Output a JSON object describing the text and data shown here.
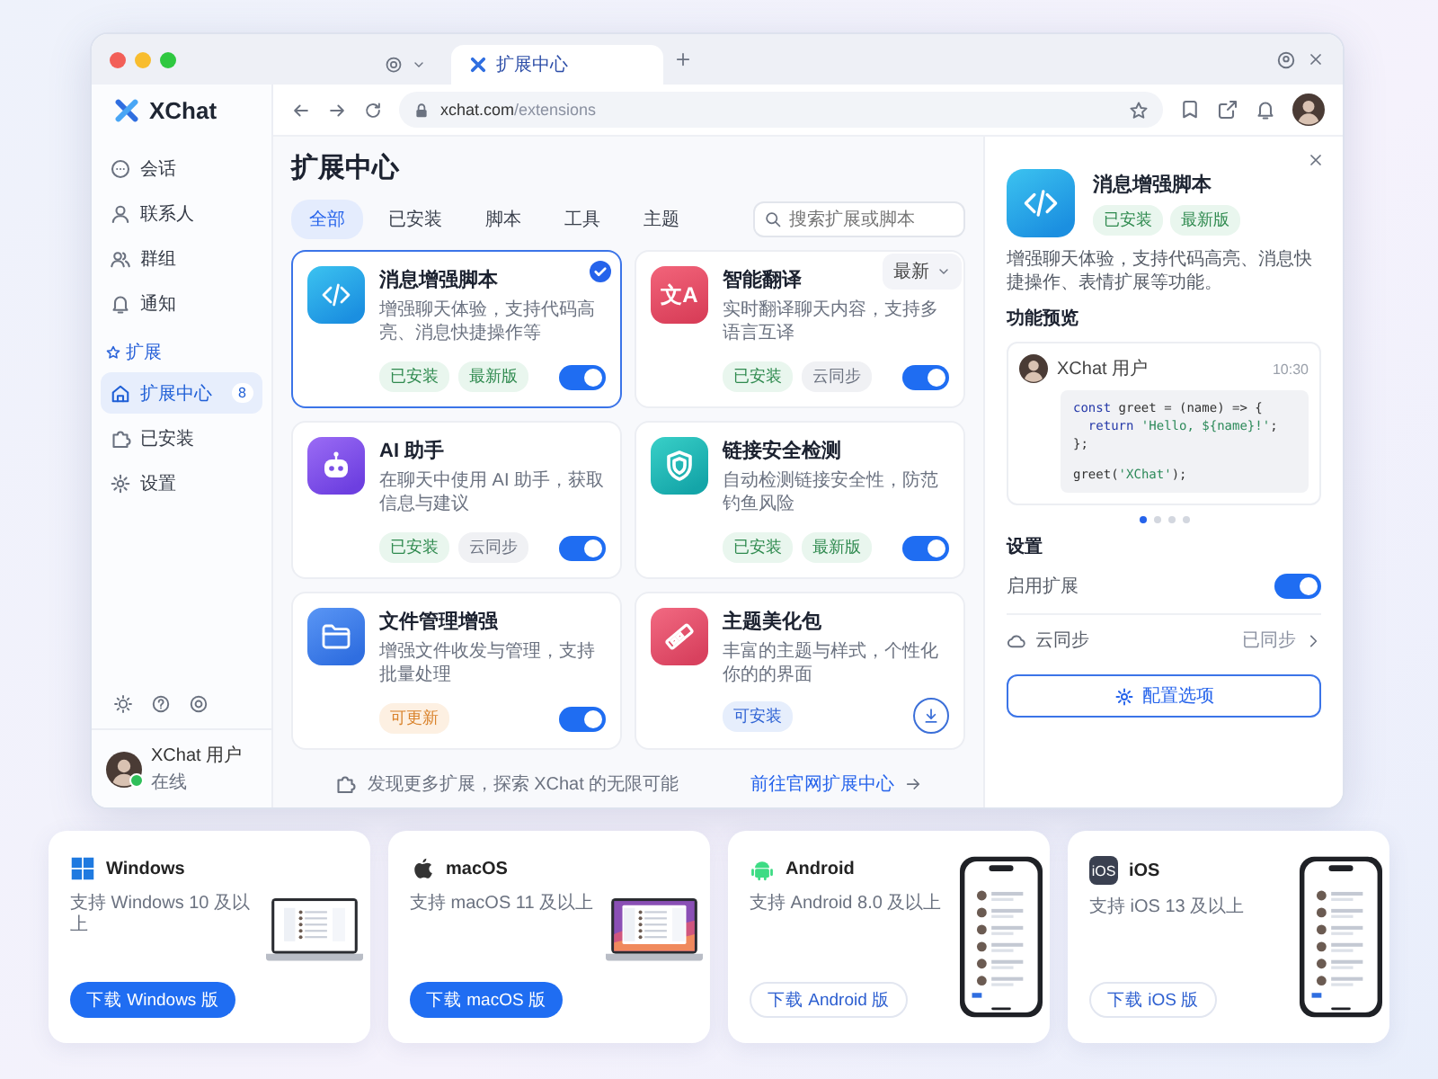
{
  "browser": {
    "tabs": [
      {
        "kind": "menu",
        "selected": false
      },
      {
        "kind": "page",
        "label": "扩展中心",
        "selected": true
      }
    ],
    "url_host": "xchat.com",
    "url_path": "/extensions"
  },
  "sidebar": {
    "app_name": "XChat",
    "groups": [
      {
        "items": [
          {
            "label": "会话",
            "kind": "chat",
            "selected": false
          },
          {
            "label": "联系人",
            "kind": "contact",
            "selected": false
          },
          {
            "label": "群组",
            "kind": "group",
            "selected": false
          },
          {
            "label": "通知",
            "kind": "bell",
            "selected": false
          }
        ]
      },
      {
        "title": "扩展",
        "items": [
          {
            "label": "扩展中心",
            "kind": "store",
            "selected": true,
            "badge": "8"
          },
          {
            "label": "已安装",
            "kind": "puzzle",
            "selected": false
          },
          {
            "label": "设置",
            "kind": "gear",
            "selected": false
          }
        ]
      }
    ],
    "user": {
      "name": "XChat 用户",
      "status": "在线",
      "online": true
    }
  },
  "main": {
    "title": "扩展中心",
    "filters": [
      {
        "label": "全部",
        "selected": true
      },
      {
        "label": "已安装",
        "selected": false
      },
      {
        "label": "脚本",
        "selected": false
      },
      {
        "label": "工具",
        "selected": false
      },
      {
        "label": "主题",
        "selected": false
      }
    ],
    "search": {
      "placeholder": "搜索扩展或脚本"
    },
    "sort": {
      "label": "最新"
    },
    "extensions": [
      {
        "name": "消息增强脚本",
        "description": "增强聊天体验，支持代码高亮、消息快捷操作等",
        "kind": "code",
        "selected": true,
        "tags": [
          {
            "label": "已安装",
            "kind": "success"
          },
          {
            "label": "最新版",
            "kind": "success"
          }
        ],
        "on": true
      },
      {
        "name": "智能翻译",
        "description": "实时翻译聊天内容，支持多语言互译",
        "kind": "translate",
        "icon_text": "文A",
        "selected": false,
        "tags": [
          {
            "label": "已安装",
            "kind": "success"
          },
          {
            "label": "云同步",
            "kind": "neutral"
          }
        ],
        "on": true
      },
      {
        "name": "AI 助手",
        "description": "在聊天中使用 AI 助手，获取信息与建议",
        "kind": "robot",
        "selected": false,
        "tags": [
          {
            "label": "已安装",
            "kind": "success"
          },
          {
            "label": "云同步",
            "kind": "neutral"
          }
        ],
        "on": true
      },
      {
        "name": "链接安全检测",
        "description": "自动检测链接安全性，防范钓鱼风险",
        "kind": "shield",
        "selected": false,
        "tags": [
          {
            "label": "已安装",
            "kind": "success"
          },
          {
            "label": "最新版",
            "kind": "success"
          }
        ],
        "on": true
      },
      {
        "name": "文件管理增强",
        "description": "增强文件收发与管理，支持批量处理",
        "kind": "folder",
        "selected": false,
        "tags": [
          {
            "label": "可更新",
            "kind": "warning"
          }
        ],
        "on": true
      },
      {
        "name": "主题美化包",
        "description": "丰富的主题与样式，个性化你的的界面",
        "kind": "brush",
        "selected": false,
        "tags": [
          {
            "label": "可安装",
            "kind": "info"
          }
        ]
      }
    ],
    "footer": {
      "text": "发现更多扩展，探索 XChat 的无限可能",
      "link": "前往官网扩展中心"
    }
  },
  "detail": {
    "name": "消息增强脚本",
    "kind": "code",
    "tags": [
      {
        "label": "已安装",
        "kind": "success"
      },
      {
        "label": "最新版",
        "kind": "success"
      }
    ],
    "description": "增强聊天体验，支持代码高亮、消息快捷操作、表情扩展等功能。",
    "preview_title": "功能预览",
    "preview": {
      "user": "XChat 用户",
      "time": "10:30",
      "code": [
        [
          [
            {
              "kind": "keyword",
              "t": "const"
            },
            {
              "kind": "plain",
              "t": " greet = (name) => {"
            }
          ],
          [
            {
              "kind": "keyword",
              "t": "  return"
            },
            {
              "kind": "string",
              "t": " 'Hello, ${name}!'"
            },
            {
              "kind": "plain",
              "t": ";"
            }
          ],
          [
            {
              "kind": "plain",
              "t": "};"
            }
          ]
        ],
        [
          [
            {
              "kind": "plain",
              "t": "greet("
            },
            {
              "kind": "string",
              "t": "'XChat'"
            },
            {
              "kind": "plain",
              "t": ");"
            }
          ]
        ]
      ]
    },
    "pages": [
      {
        "selected": true
      },
      {
        "selected": false
      },
      {
        "selected": false
      },
      {
        "selected": false
      }
    ],
    "settings_title": "设置",
    "enable": {
      "label": "启用扩展",
      "on": true
    },
    "sync": {
      "label": "云同步",
      "status": "已同步"
    },
    "config_button": "配置选项"
  },
  "downloads": [
    {
      "platform": "Windows",
      "kind": "windows",
      "requirement": "支持 Windows 10 及以上",
      "button": "下载 Windows 版",
      "primary": true,
      "wallpaper": false
    },
    {
      "platform": "macOS",
      "kind": "apple",
      "requirement": "支持 macOS 11 及以上",
      "button": "下载 macOS 版",
      "primary": true,
      "wallpaper": true
    },
    {
      "platform": "Android",
      "kind": "android",
      "requirement": "支持 Android 8.0 及以上",
      "button": "下载 Android 版",
      "primary": false
    },
    {
      "platform": "iOS",
      "kind": "ios",
      "icon_text": "iOS",
      "requirement": "支持 iOS 13 及以上",
      "button": "下载 iOS 版",
      "primary": false
    }
  ]
}
